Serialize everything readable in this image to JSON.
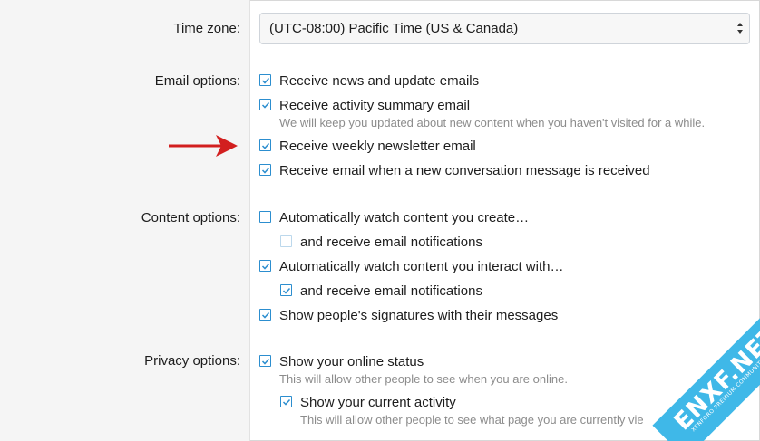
{
  "timezone": {
    "label": "Time zone:",
    "value": "(UTC-08:00) Pacific Time (US & Canada)"
  },
  "email": {
    "label": "Email options:",
    "items": [
      {
        "text": "Receive news and update emails",
        "checked": true
      },
      {
        "text": "Receive activity summary email",
        "checked": true,
        "hint": "We will keep you updated about new content when you haven't visited for a while."
      },
      {
        "text": "Receive weekly newsletter email",
        "checked": true
      },
      {
        "text": "Receive email when a new conversation message is received",
        "checked": true
      }
    ]
  },
  "content": {
    "label": "Content options:",
    "items": [
      {
        "text": "Automatically watch content you create…",
        "checked": false
      },
      {
        "text": "and receive email notifications",
        "checked": false,
        "disabled": true
      },
      {
        "text": "Automatically watch content you interact with…",
        "checked": true
      },
      {
        "text": "and receive email notifications",
        "checked": true
      },
      {
        "text": "Show people's signatures with their messages",
        "checked": true
      }
    ]
  },
  "privacy": {
    "label": "Privacy options:",
    "items": [
      {
        "text": "Show your online status",
        "checked": true,
        "hint": "This will allow other people to see when you are online."
      },
      {
        "text": "Show your current activity",
        "checked": true,
        "hint": "This will allow other people to see what page you are currently vie"
      }
    ]
  },
  "watermark": {
    "text": "ENXF.NET",
    "sub": "XENFORO PREMIUM COMMUNITY"
  },
  "colors": {
    "checkbox": "#2c8ecf",
    "arrow": "#d21f1f",
    "label_column": "#f5f5f5",
    "watermark": "#3fb8e8"
  }
}
